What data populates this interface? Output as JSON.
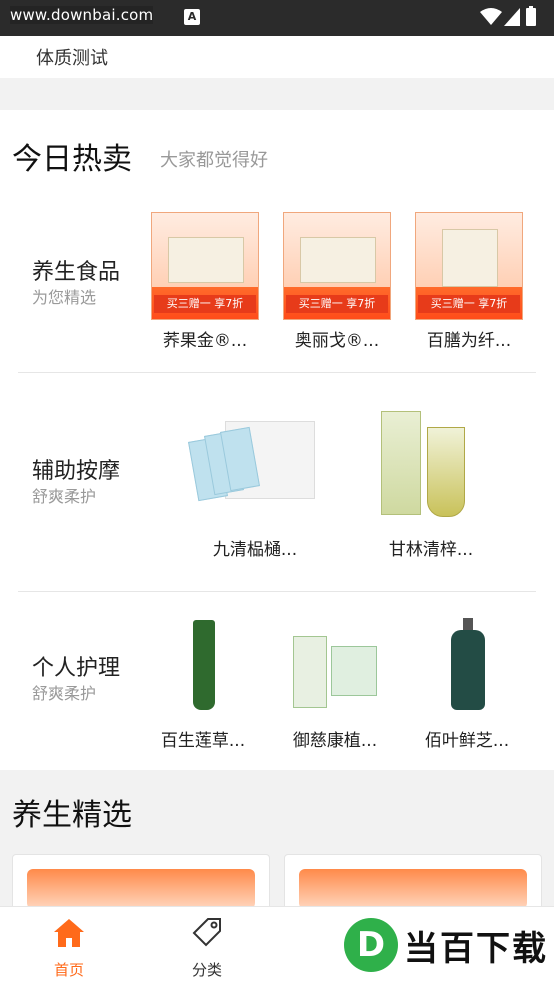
{
  "status_bar": {
    "watermark": "www.downbai.com",
    "a_icon": "A"
  },
  "top_strip": {
    "label": "体质测试"
  },
  "hot_section": {
    "title": "今日热卖",
    "subtitle": "大家都觉得好",
    "categories": [
      {
        "title": "养生食品",
        "subtitle": "为您精选",
        "products": [
          {
            "name": "荞果金®...",
            "promo": "买三赠一 享7折"
          },
          {
            "name": "奥丽戈®...",
            "promo": "买三赠一 享7折"
          },
          {
            "name": "百膳为纤...",
            "promo": "买三赠一 享7折"
          }
        ]
      },
      {
        "title": "辅助按摩",
        "subtitle": "舒爽柔护",
        "products": [
          {
            "name": "九清榀樋..."
          },
          {
            "name": "甘林清梓..."
          }
        ]
      },
      {
        "title": "个人护理",
        "subtitle": "舒爽柔护",
        "products": [
          {
            "name": "百生莲草..."
          },
          {
            "name": "御慈康植..."
          },
          {
            "name": "佰叶鲜芝..."
          }
        ]
      }
    ]
  },
  "selection": {
    "title": "养生精选"
  },
  "tabbar": {
    "tabs": [
      {
        "label": "首页",
        "icon": "home-icon",
        "active": true
      },
      {
        "label": "分类",
        "icon": "tag-icon",
        "active": false
      }
    ],
    "brand_watermark": {
      "logo_letter": "D",
      "text": "当百下载"
    }
  },
  "colors": {
    "accent": "#ff6a1a",
    "promo_red": "#e73b1a"
  }
}
